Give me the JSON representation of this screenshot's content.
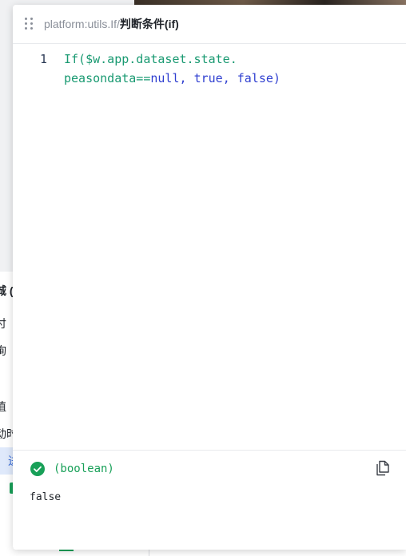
{
  "header": {
    "breadcrumb_path": "platform:utils.If",
    "breadcrumb_separator": "/",
    "breadcrumb_current": "判断条件(if)"
  },
  "editor": {
    "line_number": "1",
    "code_line1": "If($w.app.dataset.state.",
    "code_line2_pre": "peasondata==",
    "code_null": "null",
    "code_comma1": ", ",
    "code_true": "true",
    "code_comma2": ", ",
    "code_false": "false",
    "code_close": ")"
  },
  "result": {
    "type_label": "(boolean)",
    "value": "false",
    "icons": {
      "status": "check-circle-icon",
      "copy": "copy-icon"
    },
    "colors": {
      "success": "#18a058"
    }
  },
  "background_panel": {
    "rows": [
      "城 (",
      "付",
      "询",
      "值",
      "动时",
      "进"
    ]
  }
}
